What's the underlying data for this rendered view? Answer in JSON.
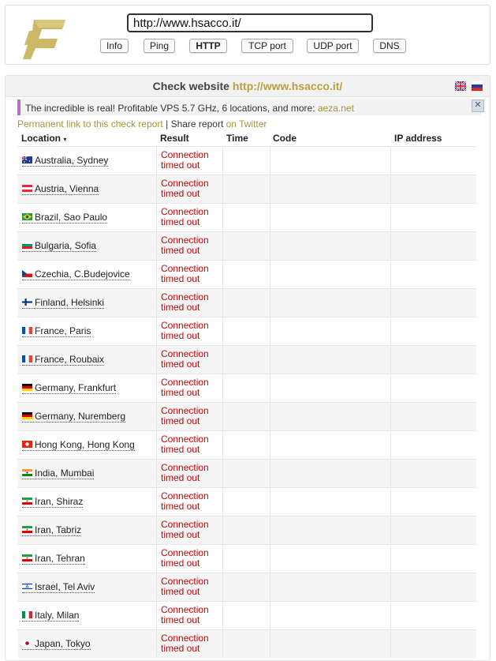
{
  "search": {
    "url_value": "http://www.hsacco.it/"
  },
  "nav": {
    "buttons": [
      {
        "label": "Info"
      },
      {
        "label": "Ping"
      },
      {
        "label": "HTTP"
      },
      {
        "label": "TCP port"
      },
      {
        "label": "UDP port"
      },
      {
        "label": "DNS"
      }
    ],
    "active": "HTTP"
  },
  "report": {
    "title_prefix": "Check website",
    "title_url": "http://www.hsacco.it/"
  },
  "ad": {
    "text": "The incredible is real! Profitable VPS 5.7 GHz, 6 locations, and more:",
    "link": "aeza.net",
    "close": "✕"
  },
  "links": {
    "permanent": "Permanent link to this check report",
    "separator": "|",
    "share_prefix": "Share report",
    "share_link": "on Twitter"
  },
  "table": {
    "headers": {
      "location": "Location",
      "sort_arrow": "▾",
      "result": "Result",
      "time": "Time",
      "code": "Code",
      "ip": "IP address"
    },
    "rows": [
      {
        "location": "Australia, Sydney",
        "flag": "au",
        "result_line1": "Connection",
        "result_line2": "timed out"
      },
      {
        "location": "Austria, Vienna",
        "flag": "at",
        "result_line1": "Connection",
        "result_line2": "timed out"
      },
      {
        "location": "Brazil, Sao Paulo",
        "flag": "br",
        "result_line1": "Connection",
        "result_line2": "timed out"
      },
      {
        "location": "Bulgaria, Sofia",
        "flag": "bg",
        "result_line1": "Connection",
        "result_line2": "timed out"
      },
      {
        "location": "Czechia, C.Budejovice",
        "flag": "cz",
        "result_line1": "Connection",
        "result_line2": "timed out"
      },
      {
        "location": "Finland, Helsinki",
        "flag": "fi",
        "result_line1": "Connection",
        "result_line2": "timed out"
      },
      {
        "location": "France, Paris",
        "flag": "fr",
        "result_line1": "Connection",
        "result_line2": "timed out"
      },
      {
        "location": "France, Roubaix",
        "flag": "fr",
        "result_line1": "Connection",
        "result_line2": "timed out"
      },
      {
        "location": "Germany, Frankfurt",
        "flag": "de",
        "result_line1": "Connection",
        "result_line2": "timed out"
      },
      {
        "location": "Germany, Nuremberg",
        "flag": "de",
        "result_line1": "Connection",
        "result_line2": "timed out"
      },
      {
        "location": "Hong Kong, Hong Kong",
        "flag": "hk",
        "result_line1": "Connection",
        "result_line2": "timed out"
      },
      {
        "location": "India, Mumbai",
        "flag": "in",
        "result_line1": "Connection",
        "result_line2": "timed out"
      },
      {
        "location": "Iran, Shiraz",
        "flag": "ir",
        "result_line1": "Connection",
        "result_line2": "timed out"
      },
      {
        "location": "Iran, Tabriz",
        "flag": "ir",
        "result_line1": "Connection",
        "result_line2": "timed out"
      },
      {
        "location": "Iran, Tehran",
        "flag": "ir",
        "result_line1": "Connection",
        "result_line2": "timed out"
      },
      {
        "location": "Israel, Tel Aviv",
        "flag": "il",
        "result_line1": "Connection",
        "result_line2": "timed out"
      },
      {
        "location": "Italy, Milan",
        "flag": "it",
        "result_line1": "Connection",
        "result_line2": "timed out"
      },
      {
        "location": "Japan, Tokyo",
        "flag": "jp",
        "result_line1": "Connection",
        "result_line2": "timed out"
      }
    ]
  },
  "colors": {
    "accent_gold": "#b8a040",
    "error_red": "#d00000",
    "ad_accent": "#b86fc0"
  }
}
